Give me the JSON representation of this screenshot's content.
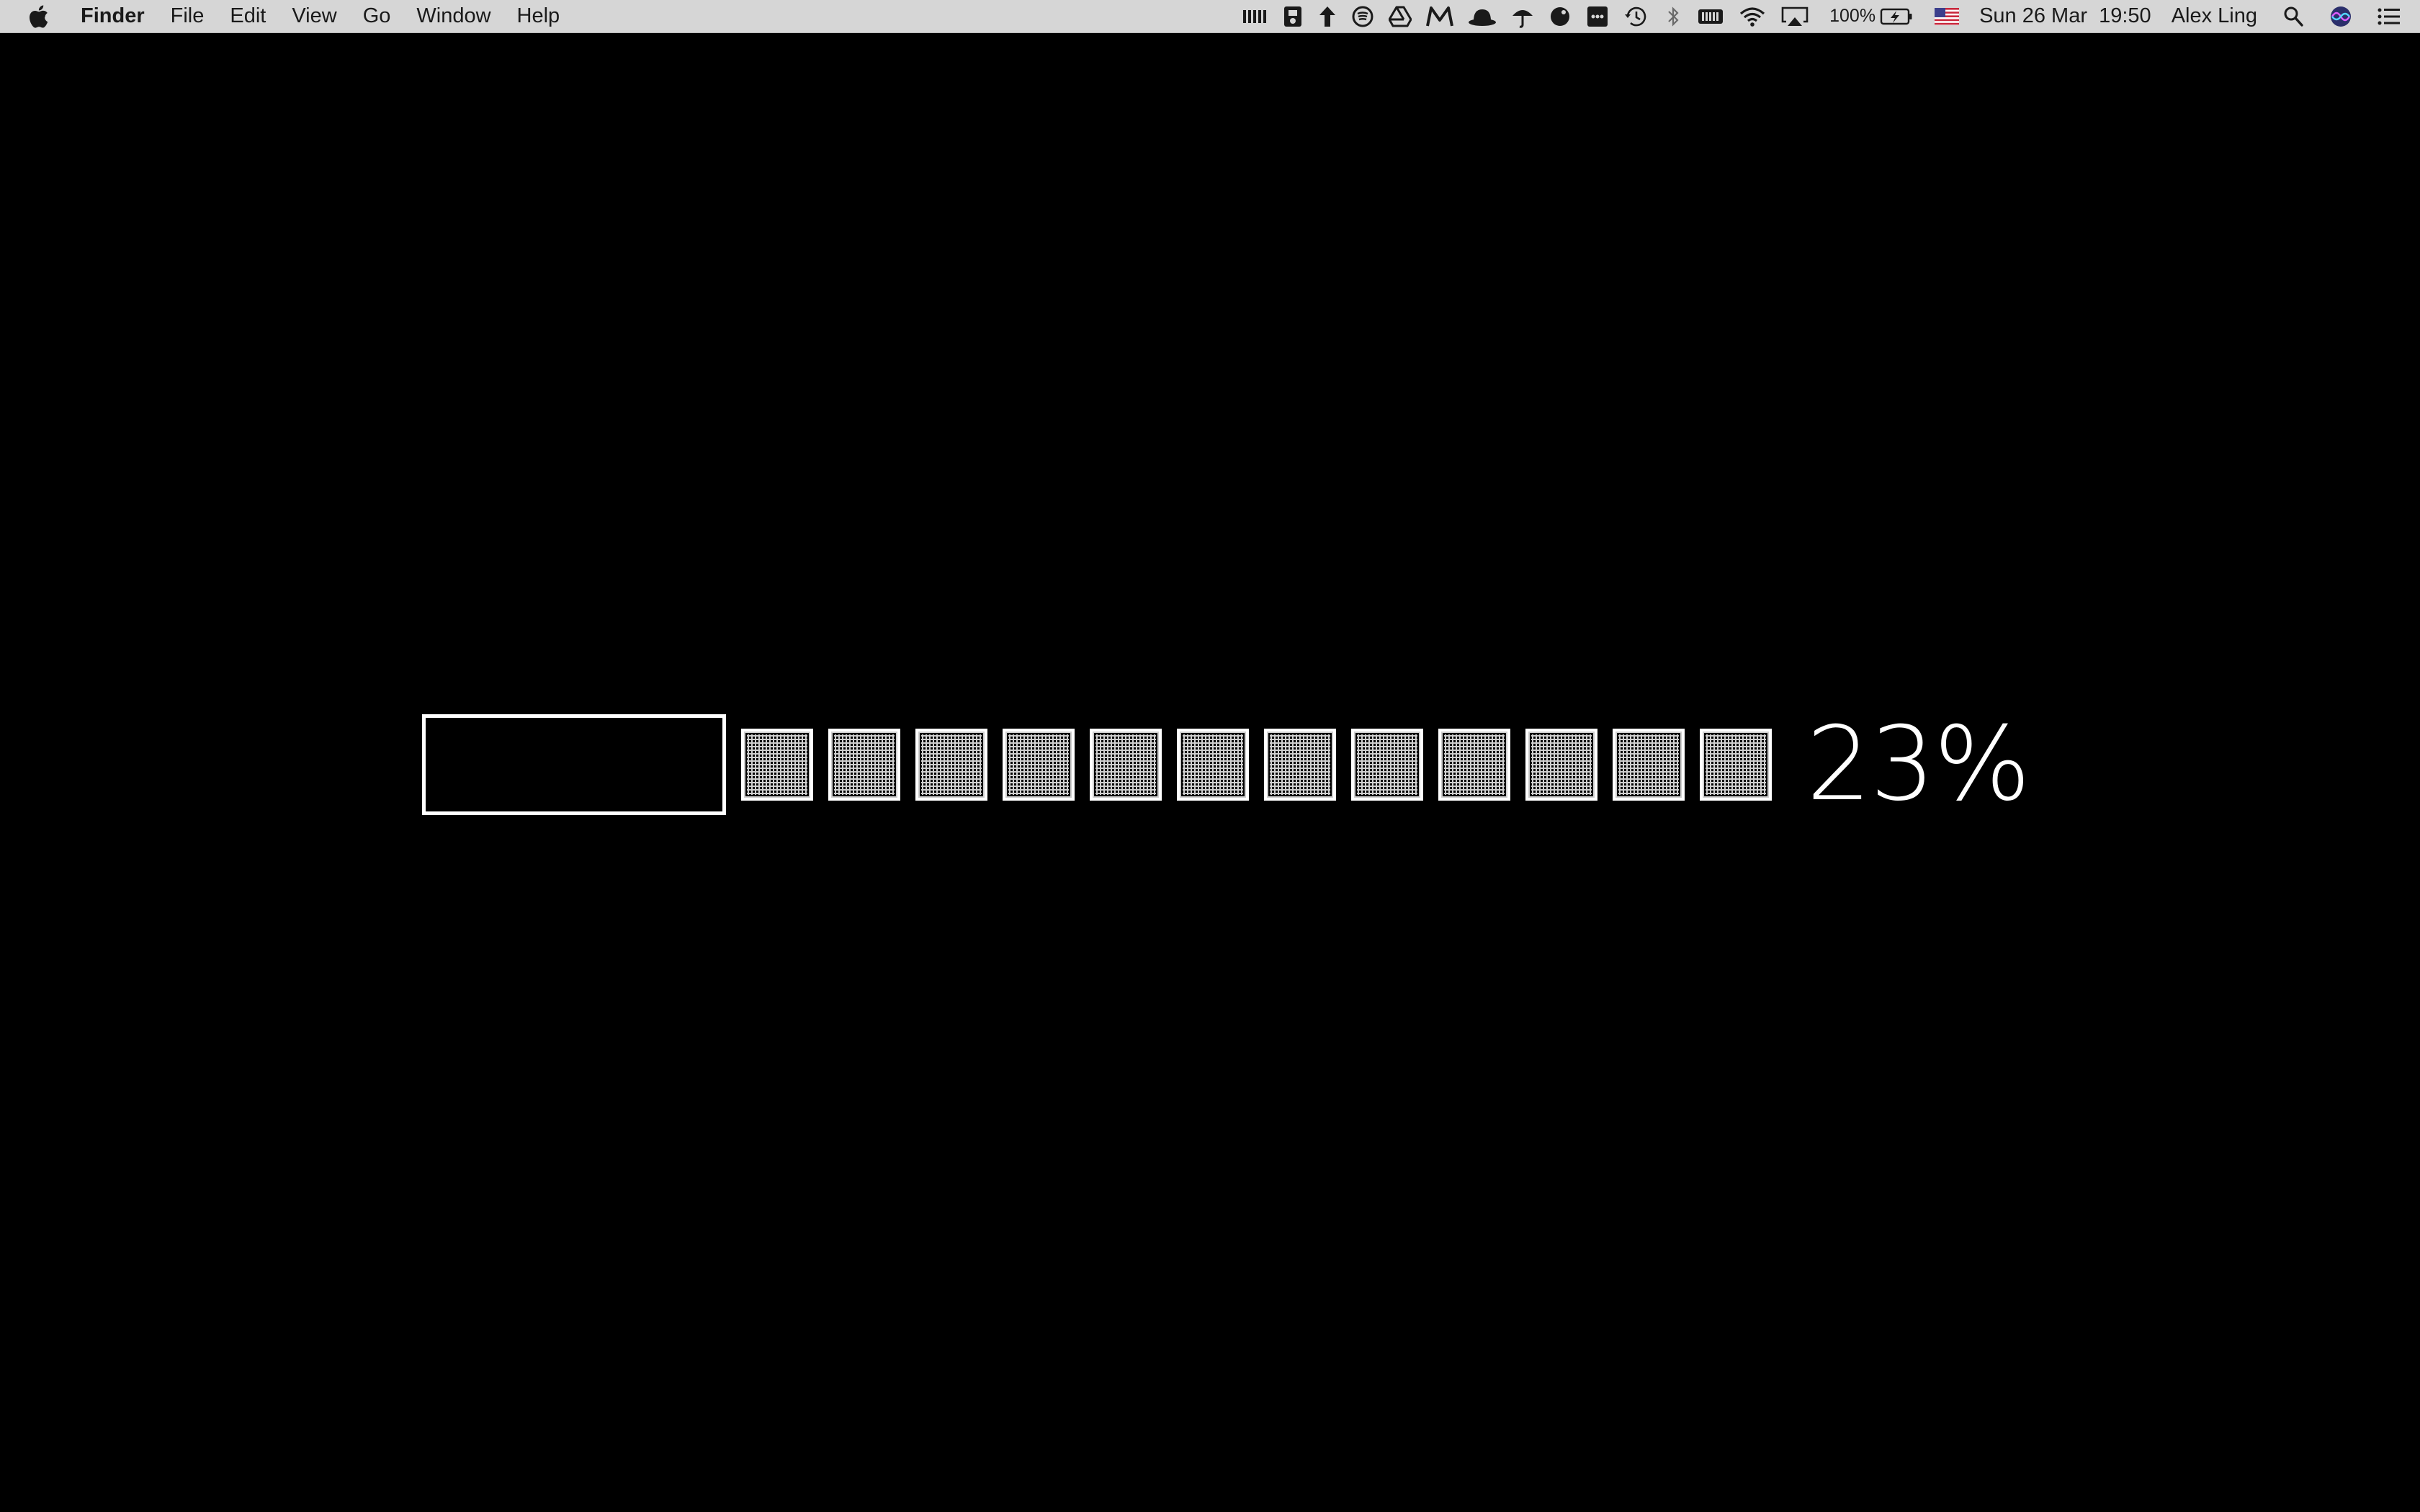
{
  "menubar": {
    "apple_icon": "apple-logo-icon",
    "app_name": "Finder",
    "menus": [
      {
        "label": "File"
      },
      {
        "label": "Edit"
      },
      {
        "label": "View"
      },
      {
        "label": "Go"
      },
      {
        "label": "Window"
      },
      {
        "label": "Help"
      }
    ],
    "status_icons": [
      "barcode-icon",
      "usb-drive-icon",
      "upload-arrow-icon",
      "spotify-icon",
      "google-drive-icon",
      "mega-icon",
      "bowler-hat-icon",
      "umbrella-icon",
      "round-shield-icon",
      "dots-box-icon",
      "time-machine-icon",
      "bluetooth-icon",
      "battery-status-icon",
      "wifi-icon",
      "airplay-icon"
    ],
    "battery_percent": "100%",
    "input_source_icon": "us-flag-icon",
    "datetime": "Sun 26 Mar  19:50",
    "user_name": "Alex Ling",
    "spotlight_icon": "search-icon",
    "siri_icon": "siri-icon",
    "notification_icon": "notification-center-icon"
  },
  "progress": {
    "value": 0.23,
    "label": "23%",
    "segments_total": 13,
    "segments_filled": 1
  },
  "colors": {
    "background": "#000000",
    "foreground": "#ffffff",
    "menubar_bg": "#d6d6d6"
  }
}
